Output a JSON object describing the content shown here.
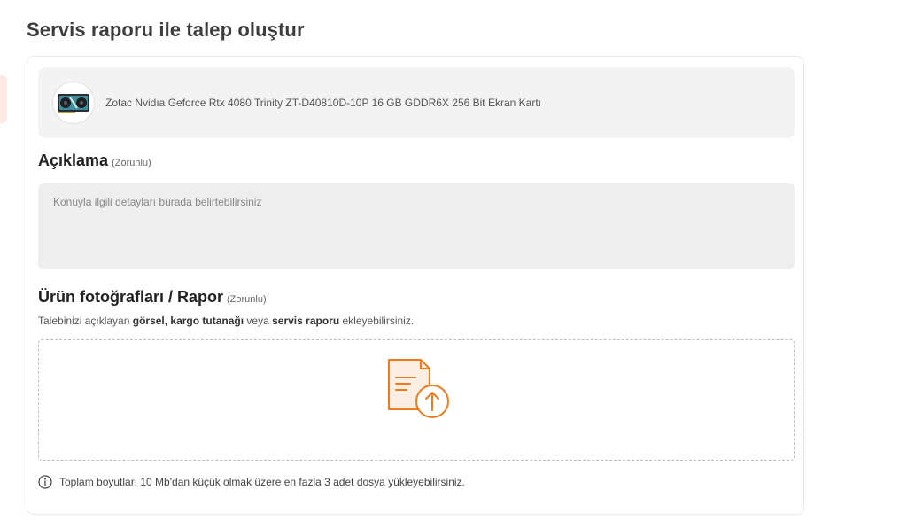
{
  "page": {
    "title": "Servis raporu ile talep oluştur"
  },
  "product": {
    "name": "Zotac Nvidıa Geforce Rtx 4080 Trinity ZT-D40810D-10P 16 GB GDDR6X 256 Bit Ekran Kartı",
    "image_icon": "graphics-card-icon"
  },
  "description": {
    "label": "Açıklama",
    "required": "(Zorunlu)",
    "placeholder": "Konuyla ilgili detayları burada belirtebilirsiniz",
    "value": ""
  },
  "photos": {
    "label": "Ürün fotoğrafları / Rapor",
    "required": "(Zorunlu)",
    "helper_prefix": "Talebinizi açıklayan ",
    "helper_bold1": "görsel, kargo tutanağı",
    "helper_mid": " veya ",
    "helper_bold2": "servis raporu",
    "helper_suffix": " ekleyebilirsiniz.",
    "upload_icon": "file-upload-icon",
    "info_icon": "info-icon",
    "info_text": "Toplam boyutları 10 Mb'dan küçük olmak üzere en fazla 3 adet dosya yükleyebilirsiniz."
  },
  "colors": {
    "accent": "#f27a1a",
    "box_bg": "#f3f3f3",
    "textarea_bg": "#eeeeee"
  }
}
